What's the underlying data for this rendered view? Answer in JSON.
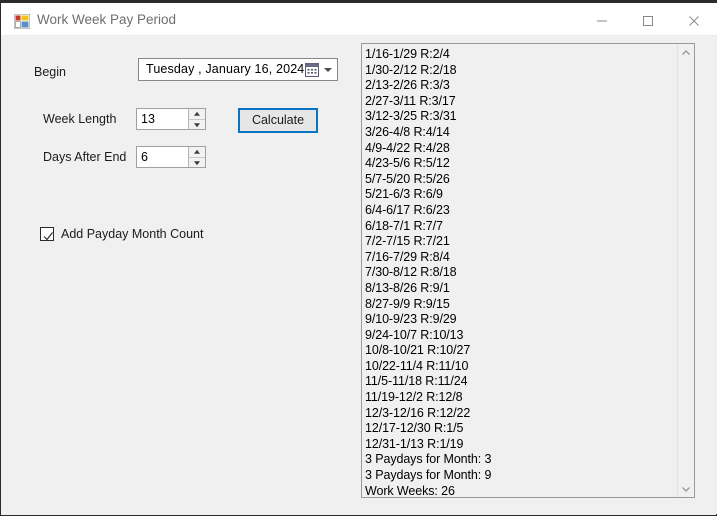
{
  "window": {
    "title": "Work Week Pay Period",
    "icon": "windows-forms-icon",
    "controls": {
      "minimize": "minimize-icon",
      "maximize": "maximize-icon",
      "close": "close-icon"
    }
  },
  "form": {
    "begin_label": "Begin",
    "date_picker": {
      "value": "Tuesday  ,  January   16, 2024",
      "calendar_icon": "calendar-icon",
      "dropdown_icon": "chevron-down-icon"
    },
    "week_length": {
      "label": "Week Length",
      "value": "13"
    },
    "days_after_end": {
      "label": "Days After End",
      "value": "6"
    },
    "calculate_button": "Calculate",
    "checkbox": {
      "label": "Add Payday Month Count",
      "checked": "checkmark-icon"
    }
  },
  "results": {
    "lines": [
      "1/16-1/29 R:2/4",
      "1/30-2/12 R:2/18",
      "2/13-2/26 R:3/3",
      "2/27-3/11 R:3/17",
      "3/12-3/25 R:3/31",
      "3/26-4/8 R:4/14",
      "4/9-4/22 R:4/28",
      "4/23-5/6 R:5/12",
      "5/7-5/20 R:5/26",
      "5/21-6/3 R:6/9",
      "6/4-6/17 R:6/23",
      "6/18-7/1 R:7/7",
      "7/2-7/15 R:7/21",
      "7/16-7/29 R:8/4",
      "7/30-8/12 R:8/18",
      "8/13-8/26 R:9/1",
      "8/27-9/9 R:9/15",
      "9/10-9/23 R:9/29",
      "9/24-10/7 R:10/13",
      "10/8-10/21 R:10/27",
      "10/22-11/4 R:11/10",
      "11/5-11/18 R:11/24",
      "11/19-12/2 R:12/8",
      "12/3-12/16 R:12/22",
      "12/17-12/30 R:1/5",
      "12/31-1/13 R:1/19",
      "3 Paydays for Month: 3",
      "3 Paydays for Month: 9",
      "Work Weeks: 26"
    ],
    "scrollbar": {
      "up_icon": "chevron-up-icon",
      "down_icon": "chevron-down-icon"
    }
  },
  "colors": {
    "form_background": "#f0f0f0",
    "title_background": "#ffffff",
    "focus_border": "#0a74c4",
    "text": "#1b1b1b",
    "title_text": "#6f6f6f"
  }
}
